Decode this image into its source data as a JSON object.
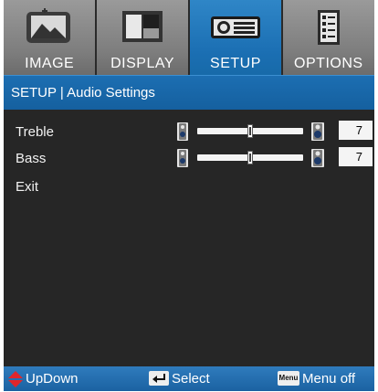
{
  "tabs": [
    {
      "label": "IMAGE",
      "icon": "image-icon",
      "active": false
    },
    {
      "label": "DISPLAY",
      "icon": "display-icon",
      "active": false
    },
    {
      "label": "SETUP",
      "icon": "projector-icon",
      "active": true
    },
    {
      "label": "OPTIONS",
      "icon": "options-list-icon",
      "active": false
    }
  ],
  "header": {
    "title": "SETUP | Audio Settings"
  },
  "settings": [
    {
      "label": "Treble",
      "value": "7"
    },
    {
      "label": "Bass",
      "value": "7"
    },
    {
      "label": "Exit"
    }
  ],
  "footer": {
    "updown_label": "UpDown",
    "select_label": "Select",
    "menu_key_label": "Menu",
    "menu_off_label": "Menu off"
  },
  "colors": {
    "accent": "#1b6fb3",
    "tab_inactive": "#8a8a8a",
    "panel": "#262626"
  }
}
